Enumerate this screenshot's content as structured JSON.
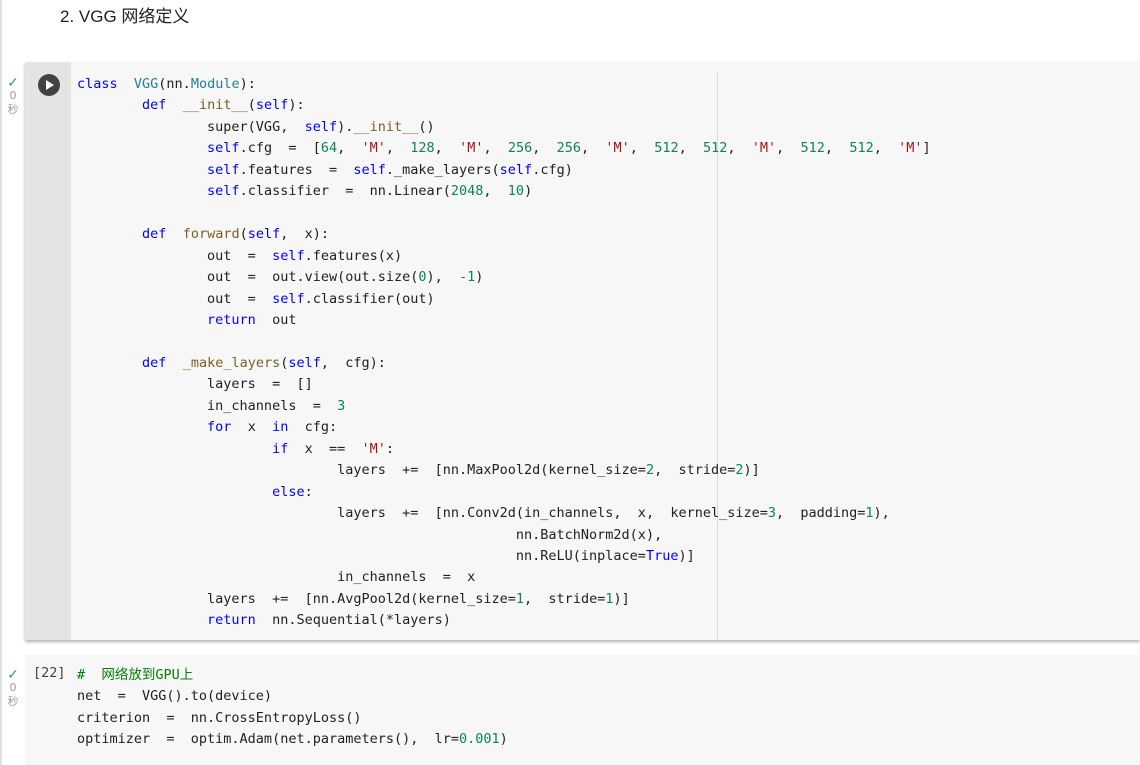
{
  "section": {
    "heading": "2. VGG 网络定义"
  },
  "cell1": {
    "check": "✓",
    "seconds": "0",
    "seconds_unit": "秒",
    "run_icon": "play-icon"
  },
  "cell2": {
    "check": "✓",
    "seconds": "0",
    "seconds_unit": "秒",
    "exec_count": "[22]"
  },
  "colors": {
    "keyword": "#0000ff",
    "number": "#098658",
    "string": "#a31515",
    "comment": "#008000",
    "check": "#34a853"
  },
  "code1": [
    [
      [
        "kw",
        "class"
      ],
      [
        "p",
        "  "
      ],
      [
        "cls",
        "VGG"
      ],
      [
        "p",
        "(nn."
      ],
      [
        "cls",
        "Module"
      ],
      [
        "p",
        "):"
      ]
    ],
    [
      [
        "p",
        "        "
      ],
      [
        "kw",
        "def"
      ],
      [
        "p",
        "  "
      ],
      [
        "fn",
        "__init__"
      ],
      [
        "p",
        "("
      ],
      [
        "kw",
        "self"
      ],
      [
        "p",
        "):"
      ]
    ],
    [
      [
        "p",
        "                super(VGG,  "
      ],
      [
        "kw",
        "self"
      ],
      [
        "p",
        ")."
      ],
      [
        "fn",
        "__init__"
      ],
      [
        "p",
        "()"
      ]
    ],
    [
      [
        "p",
        "                "
      ],
      [
        "kw",
        "self"
      ],
      [
        "p",
        ".cfg  =  ["
      ],
      [
        "num",
        "64"
      ],
      [
        "p",
        ",  "
      ],
      [
        "str",
        "'M'"
      ],
      [
        "p",
        ",  "
      ],
      [
        "num",
        "128"
      ],
      [
        "p",
        ",  "
      ],
      [
        "str",
        "'M'"
      ],
      [
        "p",
        ",  "
      ],
      [
        "num",
        "256"
      ],
      [
        "p",
        ",  "
      ],
      [
        "num",
        "256"
      ],
      [
        "p",
        ",  "
      ],
      [
        "str",
        "'M'"
      ],
      [
        "p",
        ",  "
      ],
      [
        "num",
        "512"
      ],
      [
        "p",
        ",  "
      ],
      [
        "num",
        "512"
      ],
      [
        "p",
        ",  "
      ],
      [
        "str",
        "'M'"
      ],
      [
        "p",
        ",  "
      ],
      [
        "num",
        "512"
      ],
      [
        "p",
        ",  "
      ],
      [
        "num",
        "512"
      ],
      [
        "p",
        ",  "
      ],
      [
        "str",
        "'M'"
      ],
      [
        "p",
        "]"
      ]
    ],
    [
      [
        "p",
        "                "
      ],
      [
        "kw",
        "self"
      ],
      [
        "p",
        ".features  =  "
      ],
      [
        "kw",
        "self"
      ],
      [
        "p",
        "._make_layers("
      ],
      [
        "kw",
        "self"
      ],
      [
        "p",
        ".cfg)"
      ]
    ],
    [
      [
        "p",
        "                "
      ],
      [
        "kw",
        "self"
      ],
      [
        "p",
        ".classifier  =  nn.Linear("
      ],
      [
        "num",
        "2048"
      ],
      [
        "p",
        ",  "
      ],
      [
        "num",
        "10"
      ],
      [
        "p",
        ")"
      ]
    ],
    [
      [
        "p",
        ""
      ]
    ],
    [
      [
        "p",
        "        "
      ],
      [
        "kw",
        "def"
      ],
      [
        "p",
        "  "
      ],
      [
        "fn",
        "forward"
      ],
      [
        "p",
        "("
      ],
      [
        "kw",
        "self"
      ],
      [
        "p",
        ",  x):"
      ]
    ],
    [
      [
        "p",
        "                out  =  "
      ],
      [
        "kw",
        "self"
      ],
      [
        "p",
        ".features(x)"
      ]
    ],
    [
      [
        "p",
        "                out  =  out.view(out.size("
      ],
      [
        "num",
        "0"
      ],
      [
        "p",
        "),  "
      ],
      [
        "num",
        "-1"
      ],
      [
        "p",
        ")"
      ]
    ],
    [
      [
        "p",
        "                out  =  "
      ],
      [
        "kw",
        "self"
      ],
      [
        "p",
        ".classifier(out)"
      ]
    ],
    [
      [
        "p",
        "                "
      ],
      [
        "kw",
        "return"
      ],
      [
        "p",
        "  out"
      ]
    ],
    [
      [
        "p",
        ""
      ]
    ],
    [
      [
        "p",
        "        "
      ],
      [
        "kw",
        "def"
      ],
      [
        "p",
        "  "
      ],
      [
        "fn",
        "_make_layers"
      ],
      [
        "p",
        "("
      ],
      [
        "kw",
        "self"
      ],
      [
        "p",
        ",  cfg):"
      ]
    ],
    [
      [
        "p",
        "                layers  =  []"
      ]
    ],
    [
      [
        "p",
        "                in_channels  =  "
      ],
      [
        "num",
        "3"
      ]
    ],
    [
      [
        "p",
        "                "
      ],
      [
        "kw",
        "for"
      ],
      [
        "p",
        "  x  "
      ],
      [
        "kw",
        "in"
      ],
      [
        "p",
        "  cfg:"
      ]
    ],
    [
      [
        "p",
        "                        "
      ],
      [
        "kw",
        "if"
      ],
      [
        "p",
        "  x  ==  "
      ],
      [
        "str",
        "'M'"
      ],
      [
        "p",
        ":"
      ]
    ],
    [
      [
        "p",
        "                                layers  +=  [nn.MaxPool2d(kernel_size="
      ],
      [
        "num",
        "2"
      ],
      [
        "p",
        ",  stride="
      ],
      [
        "num",
        "2"
      ],
      [
        "p",
        ")]"
      ]
    ],
    [
      [
        "p",
        "                        "
      ],
      [
        "kw",
        "else"
      ],
      [
        "p",
        ":"
      ]
    ],
    [
      [
        "p",
        "                                layers  +=  [nn.Conv2d(in_channels,  x,  kernel_size="
      ],
      [
        "num",
        "3"
      ],
      [
        "p",
        ",  padding="
      ],
      [
        "num",
        "1"
      ],
      [
        "p",
        "),"
      ]
    ],
    [
      [
        "p",
        "                                                      nn.BatchNorm2d(x),"
      ]
    ],
    [
      [
        "p",
        "                                                      nn.ReLU(inplace="
      ],
      [
        "kw",
        "True"
      ],
      [
        "p",
        ")]"
      ]
    ],
    [
      [
        "p",
        "                                in_channels  =  x"
      ]
    ],
    [
      [
        "p",
        "                layers  +=  [nn.AvgPool2d(kernel_size="
      ],
      [
        "num",
        "1"
      ],
      [
        "p",
        ",  stride="
      ],
      [
        "num",
        "1"
      ],
      [
        "p",
        ")]"
      ]
    ],
    [
      [
        "p",
        "                "
      ],
      [
        "kw",
        "return"
      ],
      [
        "p",
        "  nn.Sequential(*layers)"
      ]
    ]
  ],
  "code2": [
    [
      [
        "cm",
        "#  网络放到GPU上"
      ]
    ],
    [
      [
        "p",
        "net  =  VGG().to(device)"
      ]
    ],
    [
      [
        "p",
        "criterion  =  nn.CrossEntropyLoss()"
      ]
    ],
    [
      [
        "p",
        "optimizer  =  optim.Adam(net.parameters(),  lr="
      ],
      [
        "num",
        "0.001"
      ],
      [
        "p",
        ")"
      ]
    ]
  ]
}
